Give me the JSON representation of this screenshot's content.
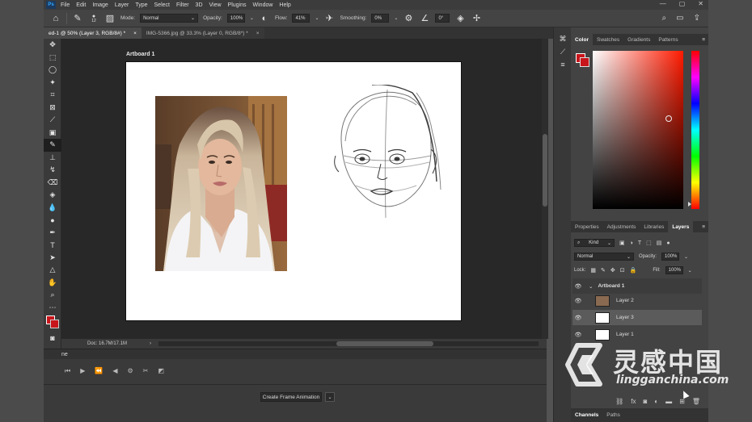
{
  "menubar": {
    "logo": "Ps",
    "items": [
      "File",
      "Edit",
      "Image",
      "Layer",
      "Type",
      "Select",
      "Filter",
      "3D",
      "View",
      "Plugins",
      "Window",
      "Help"
    ],
    "win_controls": [
      "—",
      "▢",
      "✕"
    ]
  },
  "options": {
    "brush_size": "12",
    "mode_label": "Mode:",
    "mode_value": "Normal",
    "opacity_label": "Opacity:",
    "opacity_value": "100%",
    "flow_label": "Flow:",
    "flow_value": "41%",
    "smoothing_label": "Smoothing:",
    "smoothing_value": "0%",
    "angle_value": "0°"
  },
  "doctabs": [
    {
      "label": "ed-1 @ 50% (Layer 3, RGB/8#) *",
      "close": "×"
    },
    {
      "label": "IMG-5366.jpg @ 33.3% (Layer 0, RGB/8*) *",
      "close": "×"
    }
  ],
  "canvas": {
    "artboard_label": "Artboard 1"
  },
  "statusbar": {
    "doc_info": "Doc: 16.7M/17.1M",
    "arrow": "›"
  },
  "timeline": {
    "title": "ne",
    "create_button": "Create Frame Animation",
    "dropdown_arrow": "⌄"
  },
  "color_panel": {
    "tabs": [
      "Color",
      "Swatches",
      "Gradients",
      "Patterns"
    ],
    "active_tab": "Color",
    "fg_color": "#c8151b",
    "bg_color": "#c8151b",
    "hue_color": "#ff1a00"
  },
  "layers_panel": {
    "tabs": [
      "Properties",
      "Adjustments",
      "Libraries",
      "Layers"
    ],
    "active_tab": "Layers",
    "kind_label": "Kind",
    "blend_mode": "Normal",
    "opacity_label": "Opacity:",
    "opacity_value": "100%",
    "lock_label": "Lock:",
    "fill_label": "Fill:",
    "fill_value": "100%",
    "group_name": "Artboard 1",
    "layers": [
      "Layer 2",
      "Layer 3",
      "Layer 1"
    ],
    "selected_layer": "Layer 3"
  },
  "bottom_tabs": [
    "Channels",
    "Paths"
  ],
  "watermark": {
    "chinese": "灵感中国",
    "english": "lingganchina.com"
  }
}
